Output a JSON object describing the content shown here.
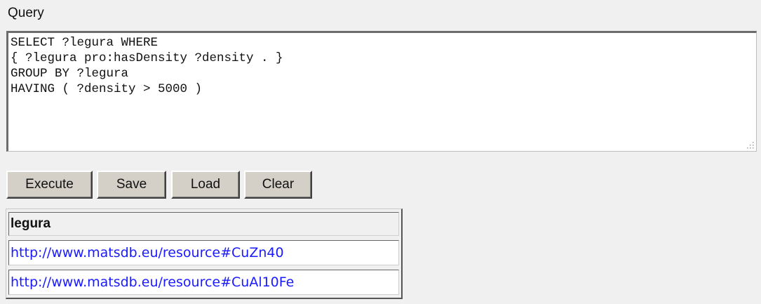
{
  "query": {
    "label": "Query",
    "lines": [
      "SELECT ?legura WHERE",
      "{ ?legura pro:hasDensity ?density . }",
      "GROUP BY ?legura",
      "HAVING ( ?density > 5000 )"
    ]
  },
  "buttons": {
    "execute": "Execute",
    "save": "Save",
    "load": "Load",
    "clear": "Clear"
  },
  "results": {
    "header": "legura",
    "rows": [
      "http://www.matsdb.eu/resource#CuZn40",
      "http://www.matsdb.eu/resource#CuAl10Fe"
    ]
  },
  "colors": {
    "link": "#1a1aff",
    "background": "#f0f0f0",
    "button_face": "#d4d0c8"
  }
}
